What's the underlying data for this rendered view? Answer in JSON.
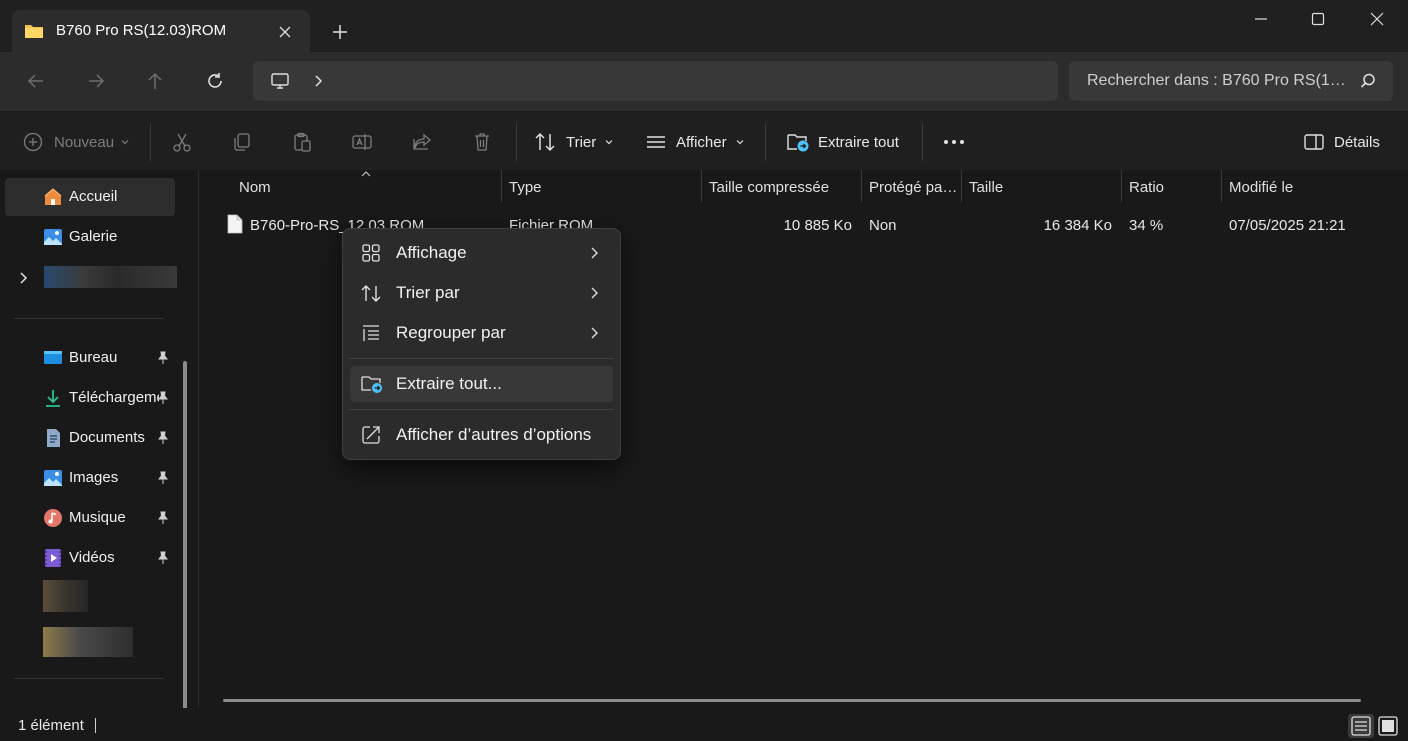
{
  "window": {
    "tab_title": "B760 Pro RS(12.03)ROM",
    "icons": {
      "tab": "folder-icon",
      "close_tab": "close-icon",
      "new_tab": "plus-icon",
      "minimize": "minimize-icon",
      "maximize": "maximize-icon",
      "close": "close-icon"
    }
  },
  "address": {
    "search_placeholder": "Rechercher dans : B760 Pro RS(1…",
    "path_icon": "monitor-icon"
  },
  "toolbar": {
    "new_label": "Nouveau",
    "sort_label": "Trier",
    "view_label": "Afficher",
    "extract_all_label": "Extraire tout",
    "details_label": "Détails",
    "more_label": "•••"
  },
  "sidebar": {
    "top_items": [
      {
        "label": "Accueil",
        "icon": "home-icon",
        "selected": true
      },
      {
        "label": "Galerie",
        "icon": "gallery-icon"
      }
    ],
    "quick_access": [
      {
        "label": "Bureau",
        "icon": "desktop-icon"
      },
      {
        "label": "Téléchargements",
        "icon": "download-icon"
      },
      {
        "label": "Documents",
        "icon": "documents-icon"
      },
      {
        "label": "Images",
        "icon": "images-icon"
      },
      {
        "label": "Musique",
        "icon": "music-icon"
      },
      {
        "label": "Vidéos",
        "icon": "videos-icon"
      }
    ]
  },
  "file_list": {
    "columns": [
      "Nom",
      "Type",
      "Taille compressée",
      "Protégé pa…",
      "Taille",
      "Ratio",
      "Modifié le"
    ],
    "rows": [
      {
        "name": "B760-Pro-RS_12.03.ROM",
        "type": "Fichier ROM",
        "compressed_size": "10 885 Ko",
        "protected": "Non",
        "size": "16 384 Ko",
        "ratio": "34 %",
        "modified": "07/05/2025 21:21"
      }
    ]
  },
  "context_menu": {
    "items": [
      {
        "label": "Affichage",
        "icon": "grid-icon",
        "submenu": true
      },
      {
        "label": "Trier par",
        "icon": "sort-icon",
        "submenu": true
      },
      {
        "label": "Regrouper par",
        "icon": "group-icon",
        "submenu": true
      },
      {
        "label": "Extraire tout...",
        "icon": "extract-icon",
        "highlighted": true
      },
      {
        "label": "Afficher d’autres d’options",
        "icon": "more-options-icon"
      }
    ]
  },
  "status": {
    "item_count": "1 élément"
  },
  "colors": {
    "background": "#191919",
    "titlebar": "#202020",
    "accent": "#4cc2ff"
  }
}
